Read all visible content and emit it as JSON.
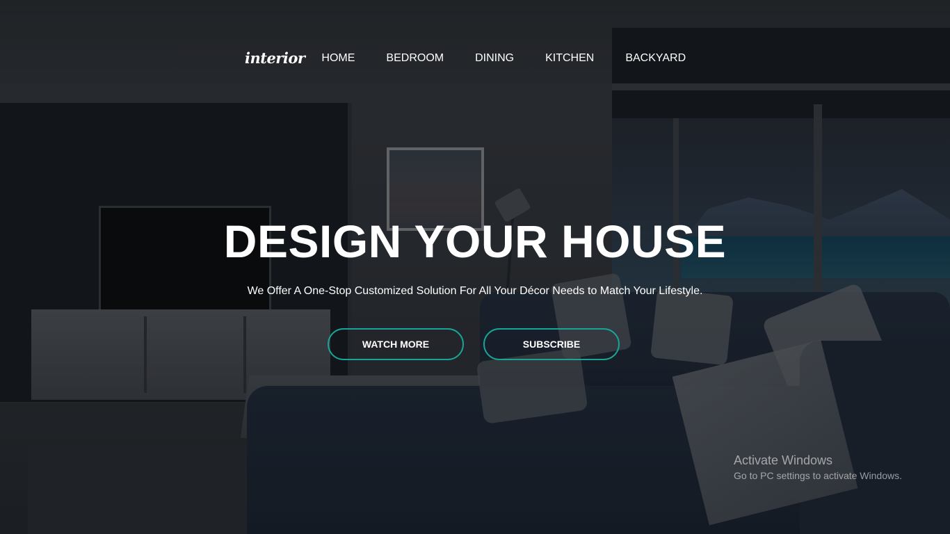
{
  "brand": {
    "logo_text": "interior"
  },
  "nav": {
    "items": [
      {
        "label": "HOME"
      },
      {
        "label": "BEDROOM"
      },
      {
        "label": "DINING"
      },
      {
        "label": "KITCHEN"
      },
      {
        "label": "BACKYARD"
      }
    ]
  },
  "hero": {
    "title": "DESIGN YOUR HOUSE",
    "subtitle": "We Offer A One-Stop Customized Solution For All Your Décor Needs to Match Your Lifestyle.",
    "buttons": {
      "watch_more": "WATCH MORE",
      "subscribe": "SUBSCRIBE"
    },
    "accent_color": "#17a696"
  },
  "watermark": {
    "title": "Activate Windows",
    "subtitle": "Go to PC settings to activate Windows."
  }
}
